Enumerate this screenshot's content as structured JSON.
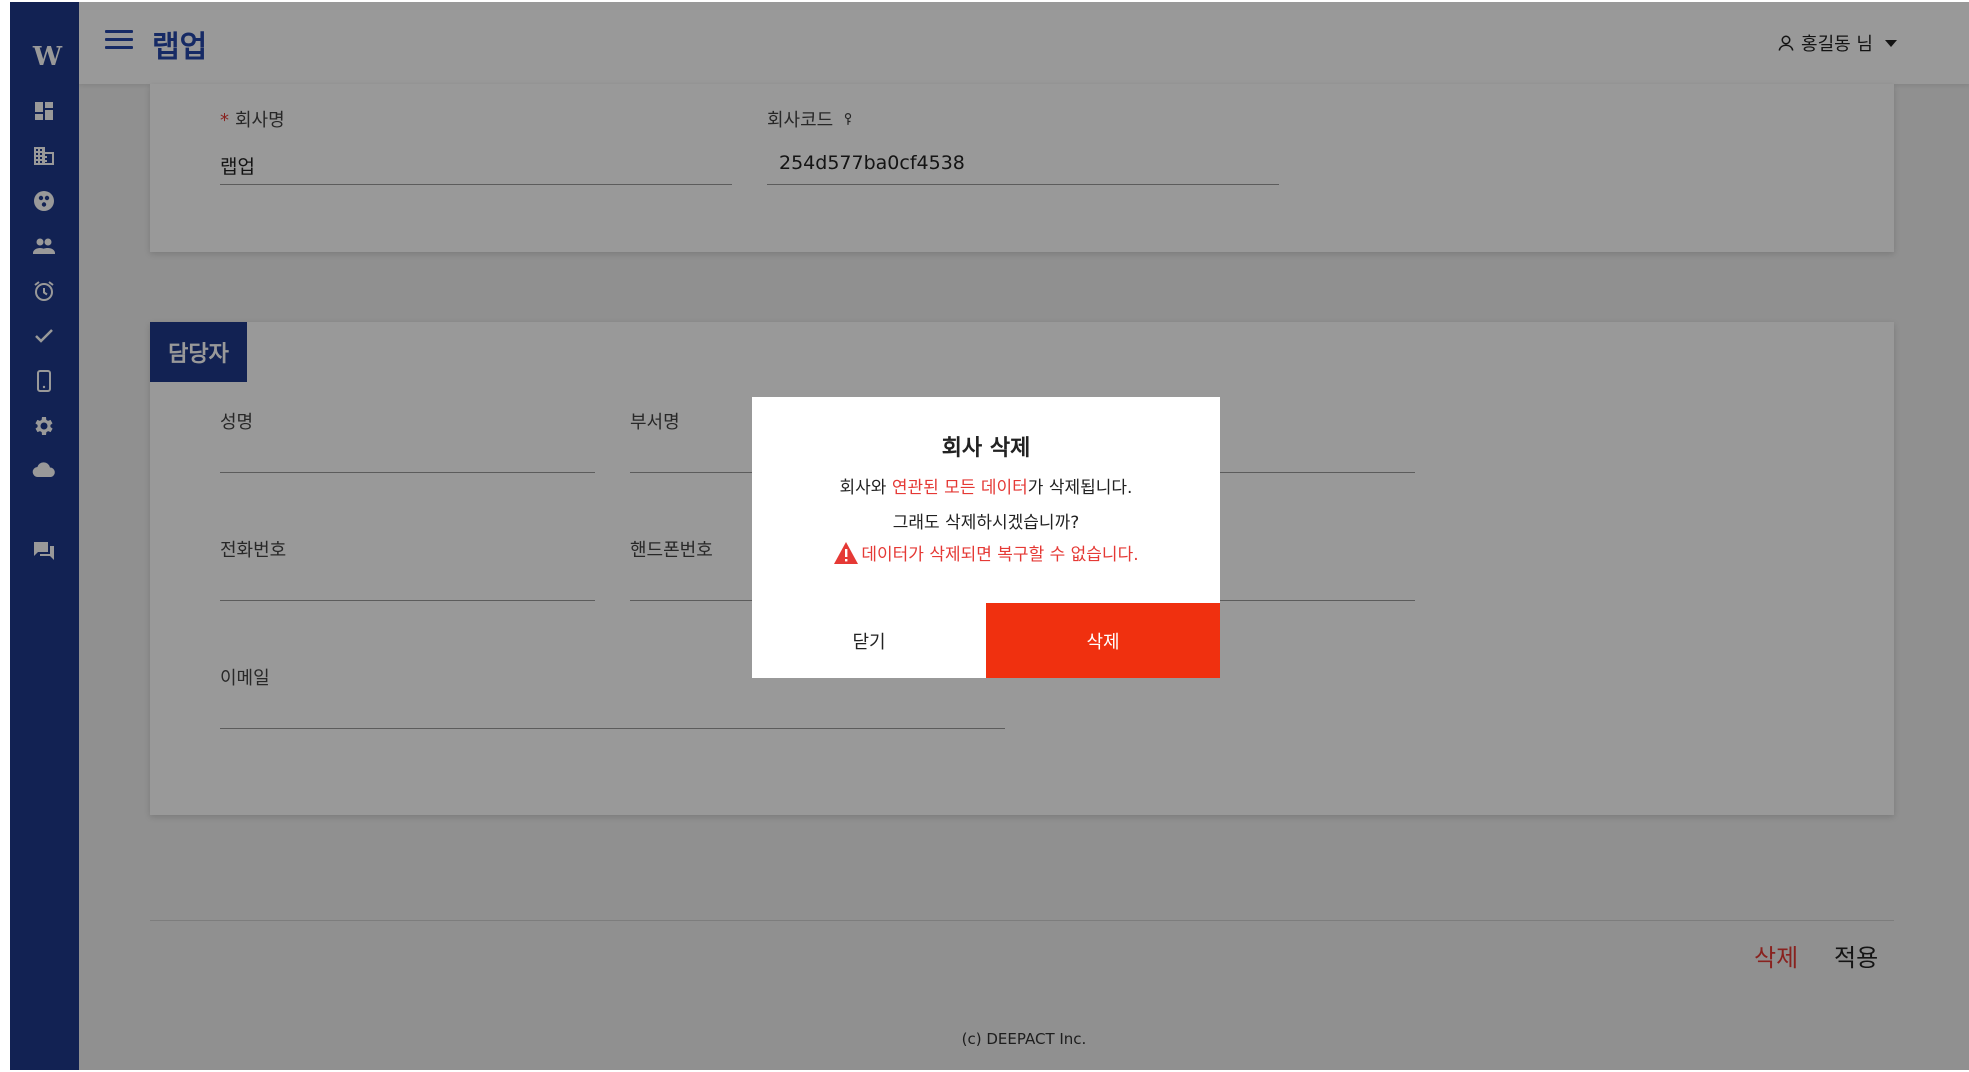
{
  "sidebar": {
    "logo": "W",
    "items": [
      {
        "icon": "dashboard-icon"
      },
      {
        "icon": "building-icon"
      },
      {
        "icon": "group-circle-icon"
      },
      {
        "icon": "people-icon"
      },
      {
        "icon": "alarm-icon"
      },
      {
        "icon": "check-icon"
      },
      {
        "icon": "phone-icon"
      },
      {
        "icon": "gear-icon"
      },
      {
        "icon": "cloud-icon"
      },
      {
        "icon": "chat-icon"
      }
    ]
  },
  "header": {
    "title": "랩업",
    "user_label": "홍길동 님"
  },
  "company": {
    "name_label": "회사명",
    "name_required_mark": "*",
    "name_value": "랩업",
    "code_label": "회사코드",
    "code_value": "254d577ba0cf4538"
  },
  "contact": {
    "section_title": "담당자",
    "name_label": "성명",
    "dept_label": "부서명",
    "phone_label": "전화번호",
    "mobile_label": "핸드폰번호",
    "email_label": "이메일"
  },
  "actions": {
    "delete_label": "삭제",
    "apply_label": "적용"
  },
  "footer": {
    "copyright": "(c) DEEPACT Inc."
  },
  "modal": {
    "title": "회사 삭제",
    "line1_before": "회사와 ",
    "line1_highlight": "연관된 모든 데이터",
    "line1_after": "가 삭제됩니다.",
    "line2": "그래도 삭제하시겠습니까?",
    "warning": "데이터가 삭제되면 복구할 수 없습니다.",
    "close_label": "닫기",
    "confirm_label": "삭제"
  },
  "colors": {
    "sidebar": "#1f3a8a",
    "accent": "#2547a8",
    "danger": "#f0300f"
  }
}
